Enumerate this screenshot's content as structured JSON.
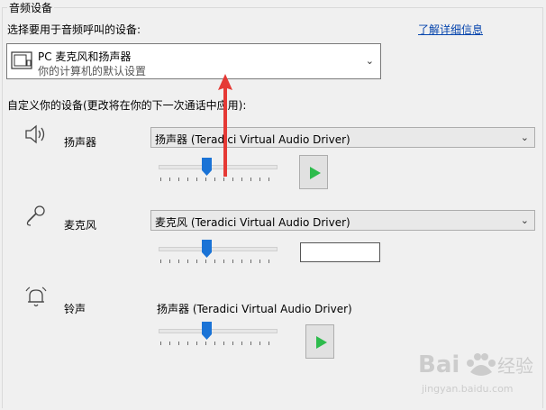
{
  "group": {
    "title": "音频设备"
  },
  "prompt": "选择要用于音频呼叫的设备:",
  "learn_more": "了解详细信息",
  "device": {
    "name": "PC 麦克风和扬声器",
    "subtitle": "你的计算机的默认设置",
    "icon": "monitor-speaker-icon"
  },
  "customize_label": "自定义你的设备(更改将在你的下一次通话中应用):",
  "rows": {
    "speaker": {
      "icon": "speaker-icon",
      "label": "扬声器",
      "value": "扬声器 (Teradici Virtual Audio Driver)",
      "volume": 0.4
    },
    "microphone": {
      "icon": "microphone-icon",
      "label": "麦克风",
      "value": "麦克风 (Teradici Virtual Audio Driver)",
      "volume": 0.4
    },
    "ringer": {
      "icon": "bell-icon",
      "label": "铃声",
      "value": "扬声器 (Teradici Virtual Audio Driver)",
      "volume": 0.4
    }
  },
  "colors": {
    "play": "#2dbb4c",
    "thumb": "#1a73d6",
    "link": "#0645ad",
    "annotation_arrow": "#e53935"
  },
  "watermark": {
    "brand": "Baidu",
    "brand_cn": "经验",
    "domain": "jingyan.baidu.com"
  }
}
